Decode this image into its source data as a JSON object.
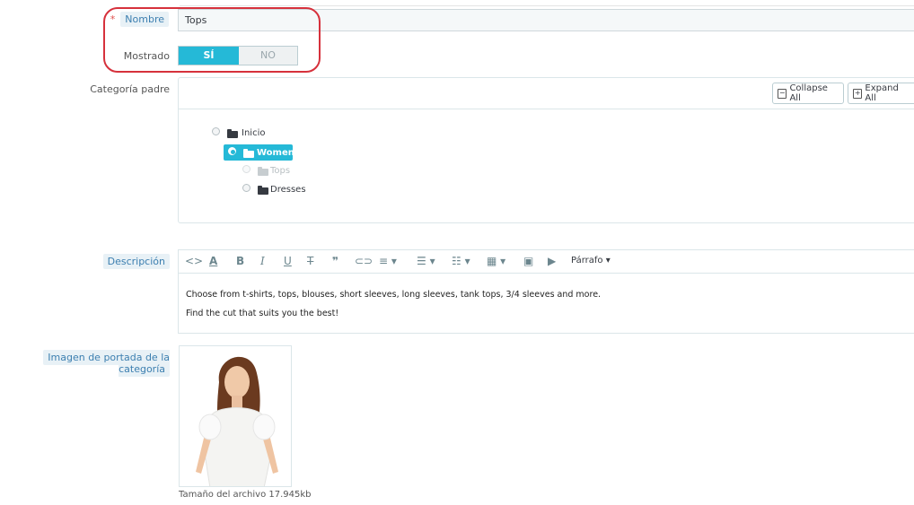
{
  "form": {
    "name_label": "Nombre",
    "name_value": "Tops",
    "required_marker": "*",
    "displayed_label": "Mostrado",
    "toggle_yes": "SÍ",
    "toggle_no": "NO",
    "toggle_selected": "SÍ",
    "parent_label": "Categoría padre",
    "description_label": "Descripción",
    "image_label": "Imagen de portada de la categoría",
    "file_size": "Tamaño del archivo 17.945kb"
  },
  "tree": {
    "collapse_label": "Collapse All",
    "expand_label": "Expand All",
    "nodes": [
      {
        "label": "Inicio",
        "checked": false,
        "disabled": false
      },
      {
        "label": "Women",
        "checked": true,
        "disabled": false
      },
      {
        "label": "Tops",
        "checked": false,
        "disabled": true
      },
      {
        "label": "Dresses",
        "checked": false,
        "disabled": false
      }
    ]
  },
  "editor": {
    "format_label": "Párrafo",
    "toolbar_icons": [
      "code-view-icon",
      "font-color-icon",
      "bold-icon",
      "italic-icon",
      "underline-icon",
      "strikethrough-icon",
      "quote-icon",
      "link-icon",
      "align-icon",
      "bullet-list-icon",
      "numbered-list-icon",
      "table-icon",
      "image-icon",
      "video-icon"
    ],
    "lines": [
      "Choose from t-shirts, tops, blouses, short sleeves, long sleeves, tank tops, 3/4 sleeves and more.",
      "Find the cut that suits you the best!"
    ]
  },
  "colors": {
    "accent": "#25b9d7",
    "annotation": "#d6313c",
    "label_highlight": "#e8f1f6"
  }
}
